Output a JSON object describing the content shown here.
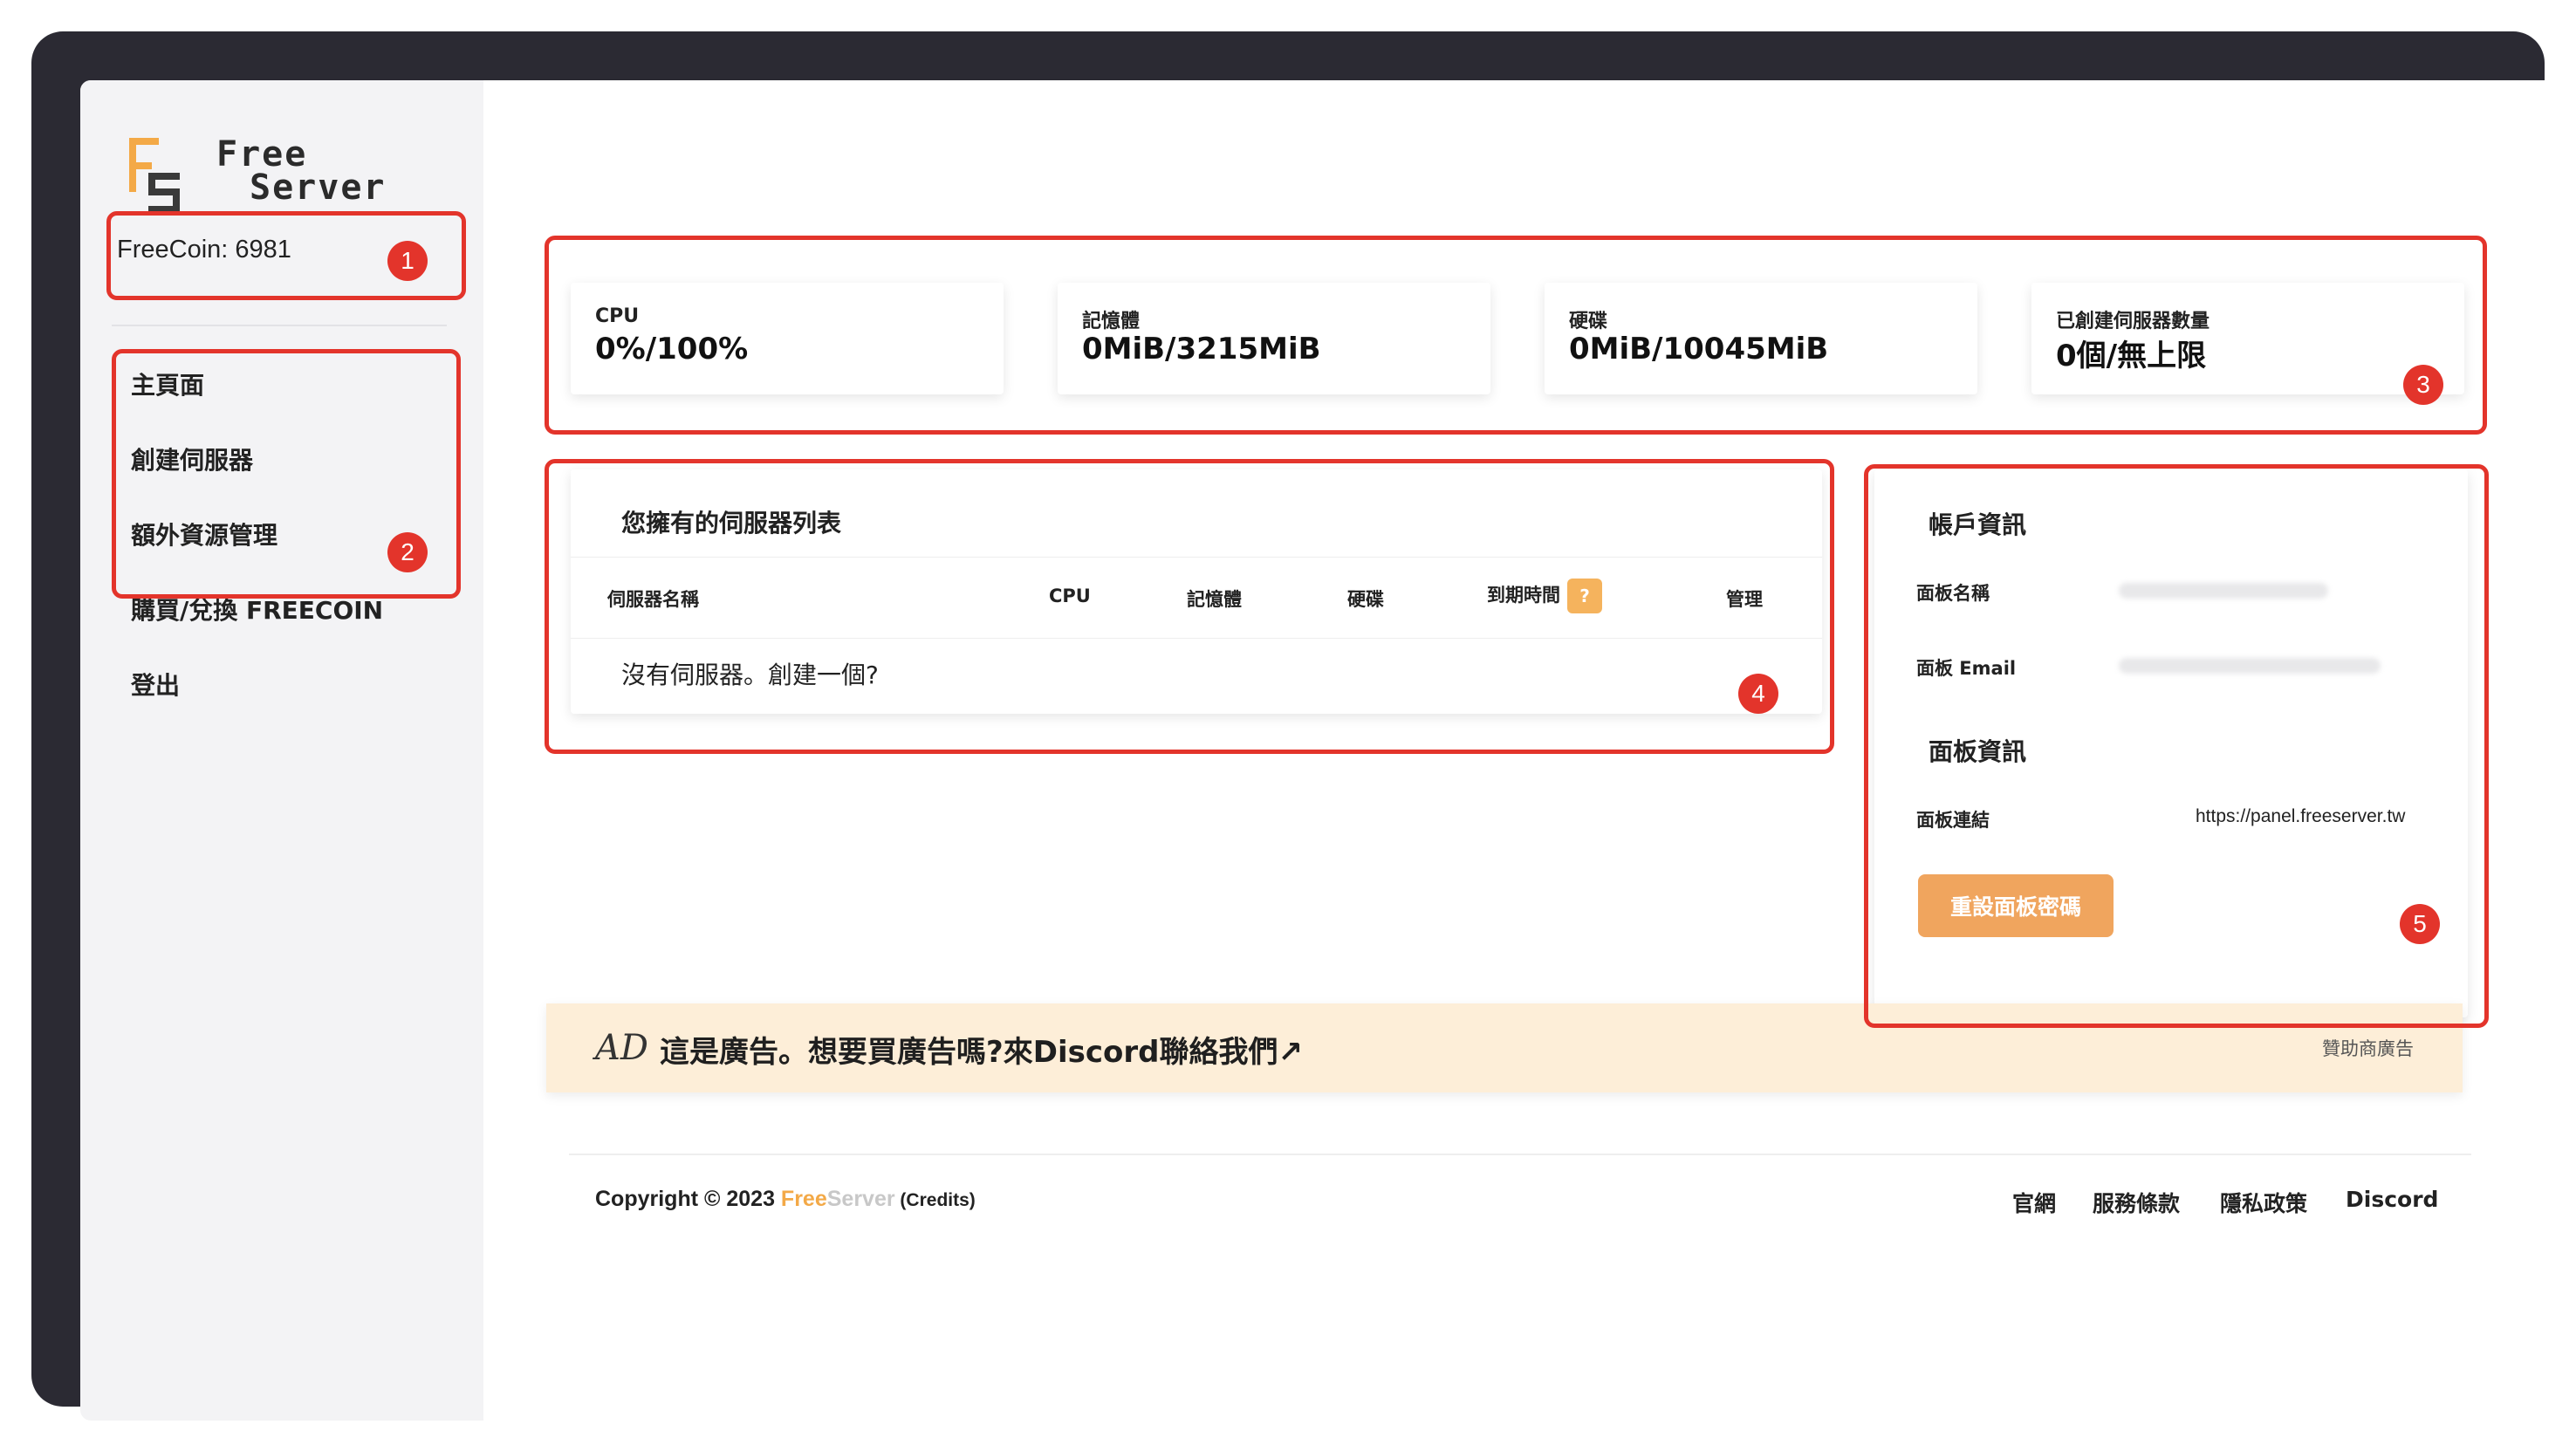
{
  "brand": {
    "line1": "Free",
    "line2": "Server"
  },
  "coin": {
    "label": "FreeCoin: 6981"
  },
  "nav": [
    {
      "label": "主頁面"
    },
    {
      "label": "創建伺服器"
    },
    {
      "label": "額外資源管理"
    },
    {
      "label": "購買/兌換 FREECOIN"
    },
    {
      "label": "登出"
    }
  ],
  "stats": [
    {
      "label": "CPU",
      "value": "0%/100%"
    },
    {
      "label": "記憶體",
      "value": "0MiB/3215MiB"
    },
    {
      "label": "硬碟",
      "value": "0MiB/10045MiB"
    },
    {
      "label": "已創建伺服器數量",
      "value": "0個/無上限"
    }
  ],
  "server_list": {
    "title": "您擁有的伺服器列表",
    "columns": [
      "伺服器名稱",
      "CPU",
      "記憶體",
      "硬碟",
      "到期時間",
      "管理"
    ],
    "help_badge": "?",
    "empty_text": "沒有伺服器。創建一個?"
  },
  "account": {
    "title": "帳戶資訊",
    "panel_name_label": "面板名稱",
    "panel_email_label": "面板 Email",
    "panel_info_title": "面板資訊",
    "panel_link_label": "面板連結",
    "panel_link_value": "https://panel.freeserver.tw",
    "reset_button": "重設面板密碼"
  },
  "ad": {
    "icon_text": "AD",
    "text": "這是廣告。想要買廣告嗎?來Discord聯絡我們↗",
    "sponsor_label": "贊助商廣告"
  },
  "footer": {
    "copyright_prefix": "Copyright © 2023 ",
    "brand_free": "Free",
    "brand_server": "Server",
    "credits": " (Credits)",
    "links": [
      "官網",
      "服務條款",
      "隱私政策",
      "Discord"
    ]
  },
  "annotations": [
    "1",
    "2",
    "3",
    "4",
    "5"
  ],
  "colors": {
    "accent": "#f0a55e",
    "annotation": "#e3342b",
    "frame": "#2b2a33"
  }
}
